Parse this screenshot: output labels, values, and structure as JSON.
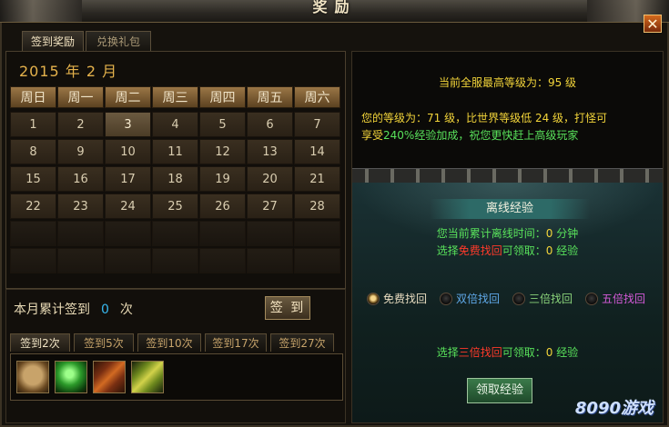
{
  "window": {
    "title": "奖励",
    "close_glyph": "✕"
  },
  "tabs": [
    {
      "label": "签到奖励",
      "active": true
    },
    {
      "label": "兑换礼包",
      "active": false
    }
  ],
  "calendar": {
    "month_label": "2015 年 2 月",
    "weekdays": [
      "周日",
      "周一",
      "周二",
      "周三",
      "周四",
      "周五",
      "周六"
    ],
    "today": "3",
    "rows": [
      [
        "1",
        "2",
        "3",
        "4",
        "5",
        "6",
        "7"
      ],
      [
        "8",
        "9",
        "10",
        "11",
        "12",
        "13",
        "14"
      ],
      [
        "15",
        "16",
        "17",
        "18",
        "19",
        "20",
        "21"
      ],
      [
        "22",
        "23",
        "24",
        "25",
        "26",
        "27",
        "28"
      ],
      [
        "",
        "",
        "",
        "",
        "",
        "",
        ""
      ],
      [
        "",
        "",
        "",
        "",
        "",
        "",
        ""
      ]
    ]
  },
  "checkin": {
    "label": "本月累计签到",
    "count": "0",
    "unit": "次",
    "button": "签 到"
  },
  "reward_tabs": [
    {
      "label": "签到2次",
      "active": true
    },
    {
      "label": "签到5次",
      "active": false
    },
    {
      "label": "签到10次",
      "active": false
    },
    {
      "label": "签到17次",
      "active": false
    },
    {
      "label": "签到27次",
      "active": false
    }
  ],
  "reward_items": [
    "treasure-chest",
    "green-orb",
    "red-token",
    "gold-token"
  ],
  "server": {
    "line_prefix": "当前全服最高等级为：",
    "max_level": "95",
    "line_suffix": " 级"
  },
  "player": {
    "p1": "您的等级为：",
    "level": "71",
    "p2": " 级，比世界等级低 ",
    "gap": "24",
    "p3": " 级，打怪可",
    "p4": "享受",
    "bonus": "240%",
    "p5": "经验加成，祝您更快赶上高级玩家"
  },
  "offline": {
    "title": "离线经验",
    "time_label": "您当前累计离线时间：",
    "time_value": "0",
    "time_unit": " 分钟",
    "free_prefix": "选择",
    "free_word": "免费找回",
    "free_mid": "可领取：",
    "free_value": "0",
    "free_unit": " 经验",
    "options": [
      {
        "label": "免费找回",
        "selected": true,
        "color": "#e8dcc0"
      },
      {
        "label": "双倍找回",
        "selected": false,
        "color": "#5fa8e8"
      },
      {
        "label": "三倍找回",
        "selected": false,
        "color": "#8ad27a"
      },
      {
        "label": "五倍找回",
        "selected": false,
        "color": "#d45ad8"
      }
    ],
    "triple_prefix": "选择",
    "triple_word": "三倍找回",
    "triple_mid": "可领取：",
    "triple_value": "0",
    "triple_unit": " 经验",
    "claim_button": "领取经验"
  },
  "watermark": "8090游戏"
}
